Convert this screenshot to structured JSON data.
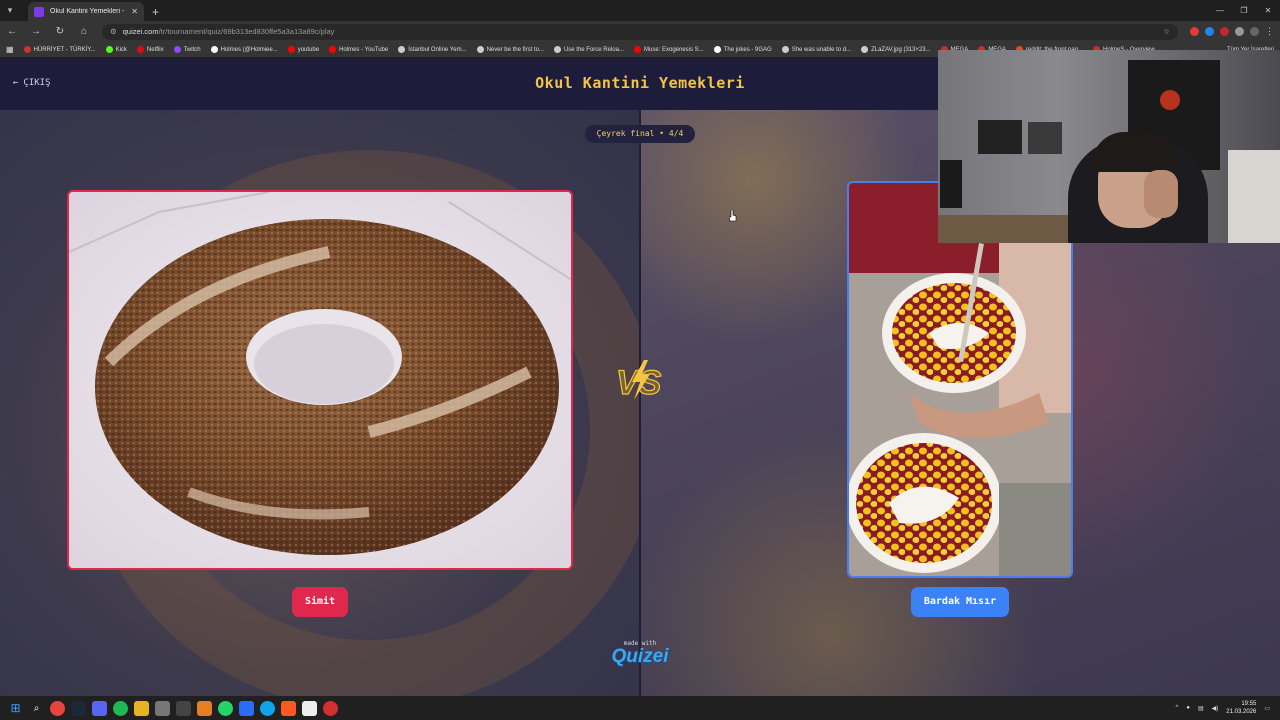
{
  "browser": {
    "tab_title": "Okul Kantini Yemekleri - Tier Li...",
    "url_host": "quizei.com",
    "url_path": "/tr/tournament/quiz/69b313ed830ffe5a3a13a89c/play",
    "bookmarks": [
      {
        "label": "HÜRRİYET - TÜRKİY...",
        "color": "#d32f2f"
      },
      {
        "label": "Kick",
        "color": "#53fc18"
      },
      {
        "label": "Netflix",
        "color": "#e50914"
      },
      {
        "label": "Twitch",
        "color": "#9146ff"
      },
      {
        "label": "Holmes (@Holmiee...",
        "color": "#ffffff"
      },
      {
        "label": "youtube",
        "color": "#ff0000"
      },
      {
        "label": "Holmes - YouTube",
        "color": "#ff0000"
      },
      {
        "label": "İstanbul Online Yem...",
        "color": "#cccccc"
      },
      {
        "label": "Never be the first to...",
        "color": "#cccccc"
      },
      {
        "label": "Use the Force Reloa...",
        "color": "#cccccc"
      },
      {
        "label": "Muse: Exogenesis S...",
        "color": "#ff0000"
      },
      {
        "label": "The jokes - 9GAG",
        "color": "#ffffff"
      },
      {
        "label": "She was unable to d...",
        "color": "#cccccc"
      },
      {
        "label": "ZLaZAV.jpg (313×23...",
        "color": "#cccccc"
      },
      {
        "label": "MEGA",
        "color": "#d9272e"
      },
      {
        "label": "MEGA",
        "color": "#d9272e"
      },
      {
        "label": "reddit: the front pag...",
        "color": "#ff4500"
      },
      {
        "label": "HolmeS - Overview",
        "color": "#d9272e"
      }
    ],
    "all_bookmarks": "Tüm Yer İşaretleri"
  },
  "header": {
    "back_label": "ÇIKIŞ",
    "title": "Okul Kantini Yemekleri"
  },
  "round_label": "Çeyrek final • 4/4",
  "left_choice": {
    "label": "Simit",
    "color": "#e0284e"
  },
  "right_choice": {
    "label": "Bardak Mısır",
    "color": "#3b82f6"
  },
  "vs_text": "VS",
  "made_with": "made with",
  "brand": "Quizei",
  "taskbar": {
    "time": "19:55",
    "date": "21.03.2026"
  }
}
